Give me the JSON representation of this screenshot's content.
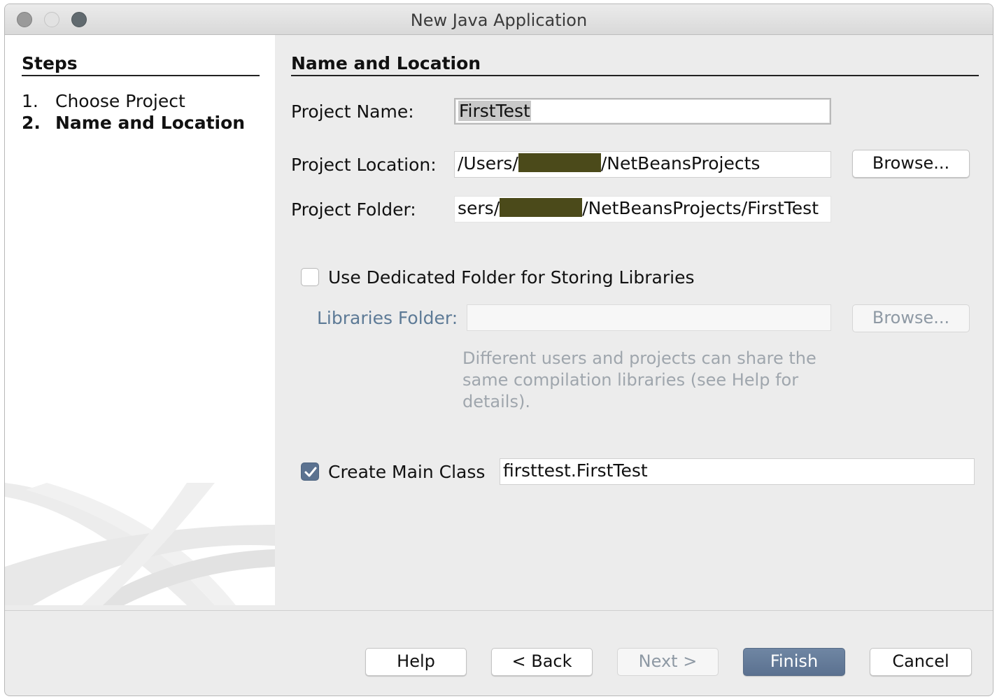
{
  "window": {
    "title": "New Java Application"
  },
  "steps": {
    "heading": "Steps",
    "items": [
      {
        "number": "1.",
        "label": "Choose Project"
      },
      {
        "number": "2.",
        "label": "Name and Location"
      }
    ]
  },
  "section": {
    "heading": "Name and Location"
  },
  "project_name": {
    "label": "Project Name:",
    "value": "FirstTest"
  },
  "project_location": {
    "label": "Project Location:",
    "value_prefix": "/Users/",
    "value_suffix": "/NetBeansProjects",
    "browse_label": "Browse..."
  },
  "project_folder": {
    "label": "Project Folder:",
    "value_prefix": "sers/",
    "value_suffix": "/NetBeansProjects/FirstTest"
  },
  "libraries": {
    "checkbox_label": "Use Dedicated Folder for Storing Libraries",
    "checked": false,
    "folder_label": "Libraries Folder:",
    "folder_value": "",
    "browse_label": "Browse...",
    "hint_lines": [
      "Different users and projects can share the",
      "same compilation libraries (see Help for",
      "details)."
    ]
  },
  "main_class": {
    "checkbox_label": "Create Main Class",
    "checked": true,
    "value": "firsttest.FirstTest"
  },
  "footer": {
    "help": "Help",
    "back": "< Back",
    "next": "Next >",
    "finish": "Finish",
    "cancel": "Cancel"
  },
  "colors": {
    "accent": "#5b7290",
    "redaction": "#4b4a1a"
  }
}
